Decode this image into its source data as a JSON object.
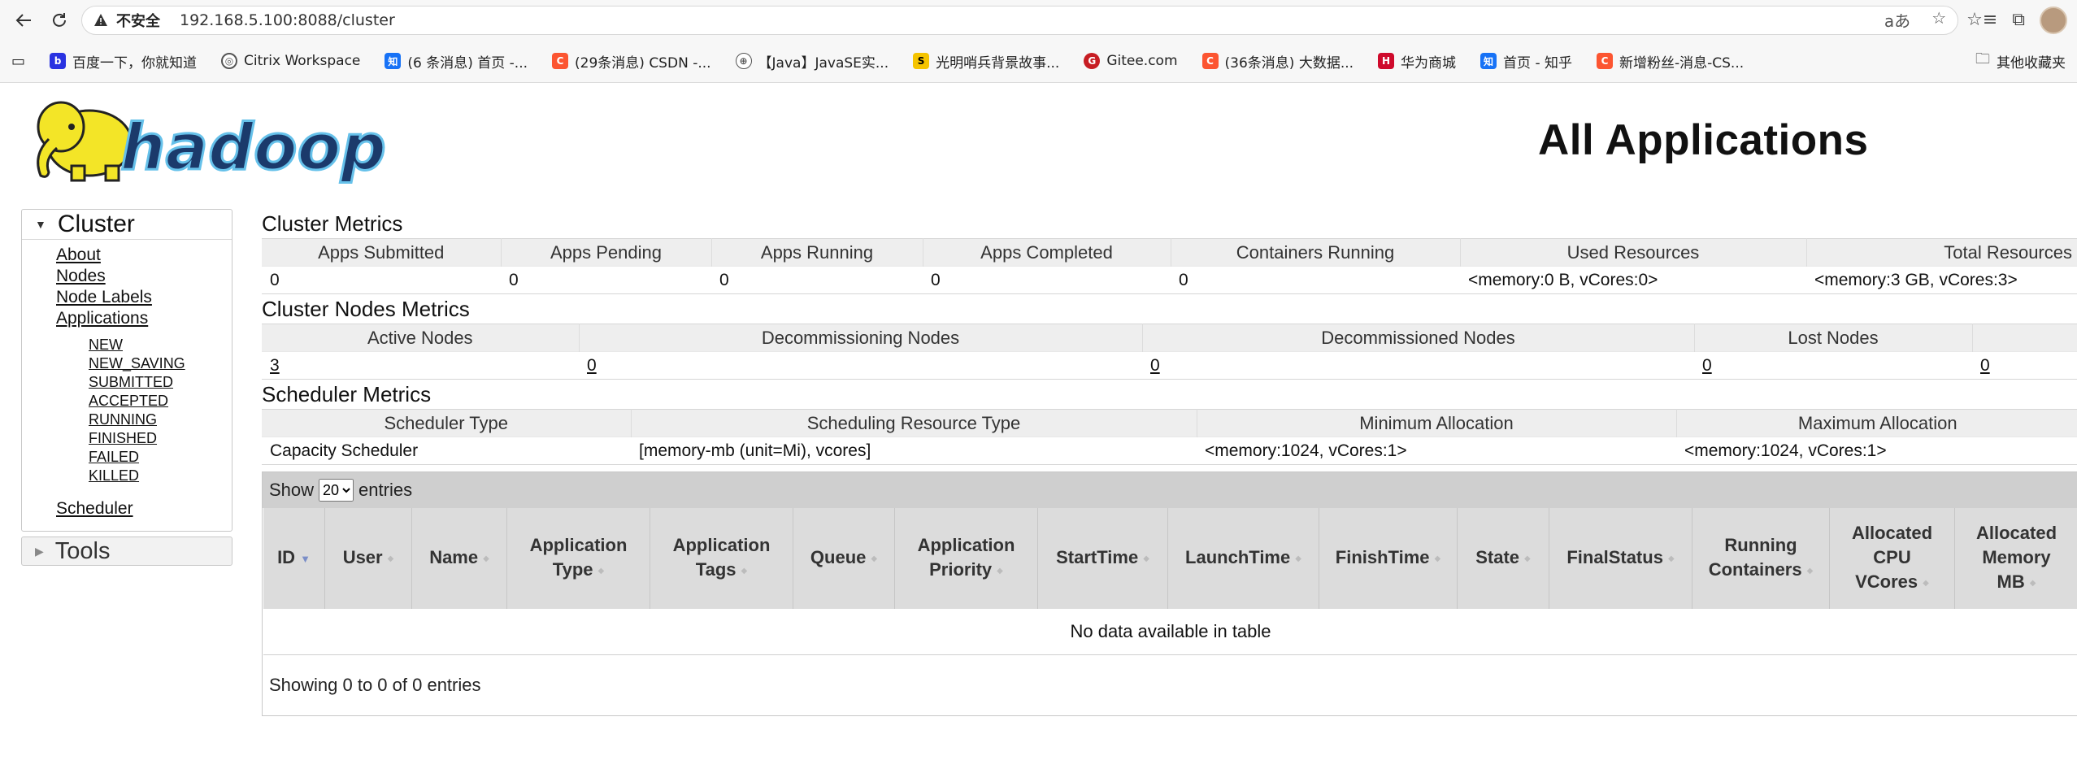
{
  "browser": {
    "insecure_label": "不安全",
    "url": "192.168.5.100:8088/cluster",
    "bookmarks": [
      {
        "label": "百度一下，你就知道",
        "icon": "baidu-icon",
        "color": "#2932e1"
      },
      {
        "label": "Citrix Workspace",
        "icon": "citrix-icon",
        "color": "#555555"
      },
      {
        "label": "(6 条消息) 首页 -...",
        "icon": "zhihu-icon",
        "color": "#1772f6"
      },
      {
        "label": "(29条消息) CSDN -...",
        "icon": "csdn-icon",
        "color": "#fc5531"
      },
      {
        "label": "【Java】JavaSE实...",
        "icon": "globe-icon",
        "color": "#666666"
      },
      {
        "label": "光明哨兵背景故事...",
        "icon": "sogou-icon",
        "color": "#f5c400"
      },
      {
        "label": "Gitee.com",
        "icon": "gitee-icon",
        "color": "#c71d23"
      },
      {
        "label": "(36条消息) 大数据...",
        "icon": "csdn-icon",
        "color": "#fc5531"
      },
      {
        "label": "华为商城",
        "icon": "vmall-icon",
        "color": "#cf0a2c"
      },
      {
        "label": "首页 - 知乎",
        "icon": "zhihu-icon",
        "color": "#1772f6"
      },
      {
        "label": "新增粉丝-消息-CS...",
        "icon": "csdn-icon",
        "color": "#fc5531"
      }
    ],
    "other_bookmarks": "其他收藏夹"
  },
  "header": {
    "logo_text": "hadoop",
    "title": "All Applications"
  },
  "sidebar": {
    "cluster_label": "Cluster",
    "links": [
      "About",
      "Nodes",
      "Node Labels",
      "Applications"
    ],
    "app_states": [
      "NEW",
      "NEW_SAVING",
      "SUBMITTED",
      "ACCEPTED",
      "RUNNING",
      "FINISHED",
      "FAILED",
      "KILLED"
    ],
    "scheduler_label": "Scheduler",
    "tools_label": "Tools"
  },
  "cluster_metrics": {
    "title": "Cluster Metrics",
    "headers": [
      "Apps Submitted",
      "Apps Pending",
      "Apps Running",
      "Apps Completed",
      "Containers Running",
      "Used Resources",
      "Total Resources"
    ],
    "values": [
      "0",
      "0",
      "0",
      "0",
      "0",
      "<memory:0 B, vCores:0>",
      "<memory:3 GB, vCores:3>"
    ]
  },
  "nodes_metrics": {
    "title": "Cluster Nodes Metrics",
    "headers": [
      "Active Nodes",
      "Decommissioning Nodes",
      "Decommissioned Nodes",
      "Lost Nodes",
      ""
    ],
    "values": [
      "3",
      "0",
      "0",
      "0",
      "0"
    ]
  },
  "scheduler_metrics": {
    "title": "Scheduler Metrics",
    "headers": [
      "Scheduler Type",
      "Scheduling Resource Type",
      "Minimum Allocation",
      "Maximum Allocation"
    ],
    "values": [
      "Capacity Scheduler",
      "[memory-mb (unit=Mi), vcores]",
      "<memory:1024, vCores:1>",
      "<memory:1024, vCores:1>"
    ]
  },
  "apps_table": {
    "show_label": "Show",
    "entries_label": "entries",
    "page_size": "20",
    "columns": [
      "ID",
      "User",
      "Name",
      "Application Type",
      "Application Tags",
      "Queue",
      "Application Priority",
      "StartTime",
      "LaunchTime",
      "FinishTime",
      "State",
      "FinalStatus",
      "Running Containers",
      "Allocated CPU VCores",
      "Allocated Memory MB"
    ],
    "empty_message": "No data available in table",
    "footer": "Showing 0 to 0 of 0 entries"
  }
}
